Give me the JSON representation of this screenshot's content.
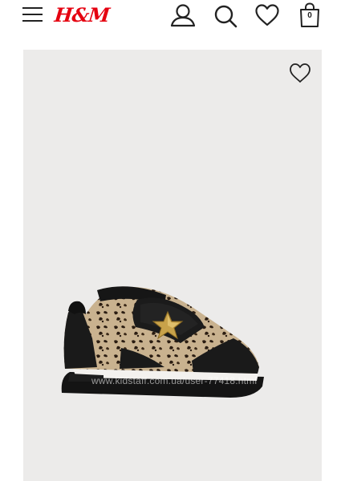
{
  "header": {
    "menu_icon": "hamburger-menu-icon",
    "logo_text": "H&M",
    "brand_color": "#e50010",
    "account_icon": "user-icon",
    "search_icon": "search-icon",
    "wishlist_icon": "heart-icon",
    "bag_icon": "shopping-bag-icon",
    "bag_count": "0"
  },
  "product": {
    "favorite_icon": "heart-icon",
    "image_subject": "sneaker-icon",
    "watermark": "www.kidstaff.com.ua/user-77418.html"
  },
  "colors": {
    "media_background": "#ecebea",
    "text": "#222222"
  }
}
